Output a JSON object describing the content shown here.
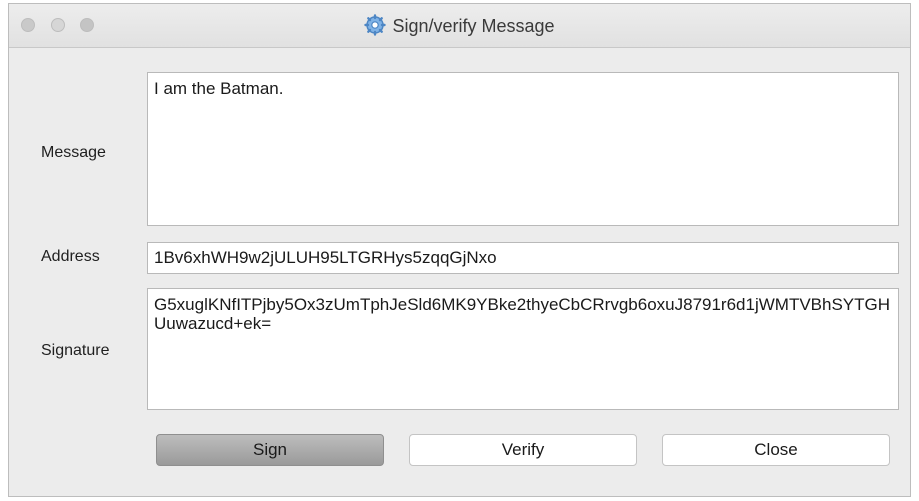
{
  "window": {
    "title": "Sign/verify Message",
    "title_icon": "app-gear-icon"
  },
  "form": {
    "message_label": "Message",
    "message_value": "I am the Batman.",
    "address_label": "Address",
    "address_value": "1Bv6xhWH9w2jULUH95LTGRHys5zqqGjNxo",
    "signature_label": "Signature",
    "signature_value": "G5xuglKNfITPjby5Ox3zUmTphJeSld6MK9YBke2thyeCbCRrvgb6oxuJ8791r6d1jWMTVBhSYTGHUuwazucd+ek="
  },
  "buttons": {
    "sign": "Sign",
    "verify": "Verify",
    "close": "Close"
  }
}
